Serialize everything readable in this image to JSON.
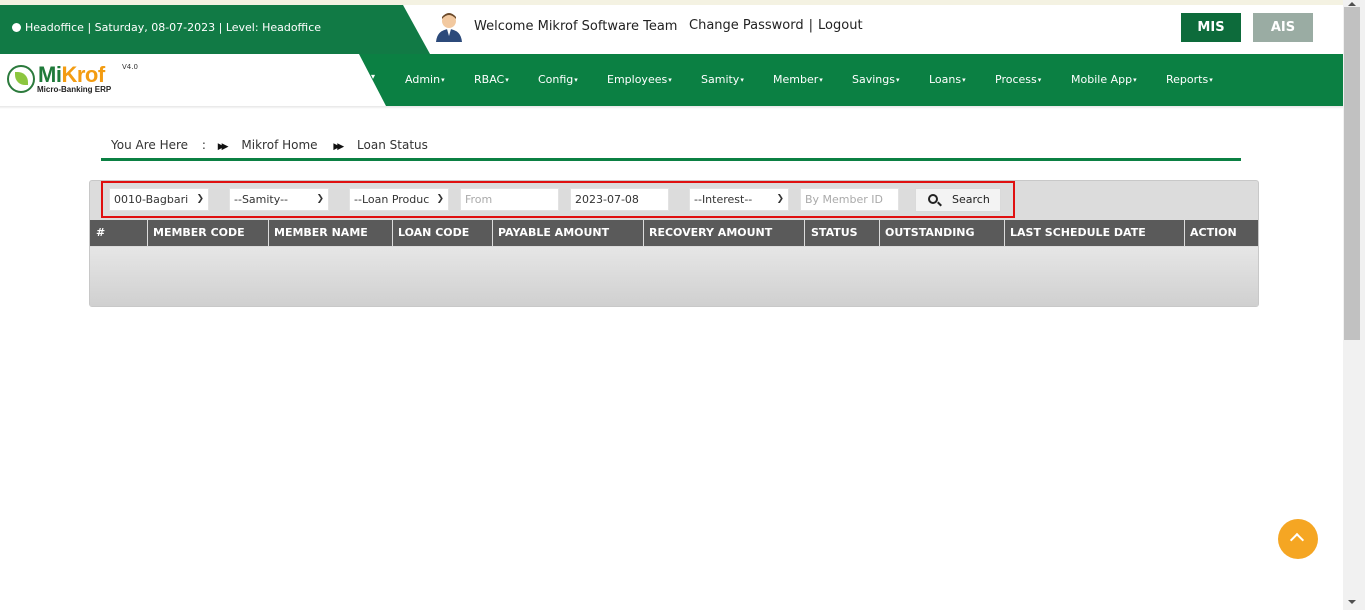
{
  "header": {
    "info_text": "Headoffice | Saturday, 08-07-2023 | Level: Headoffice",
    "welcome": "Welcome Mikrof Software Team",
    "change_password": "Change Password",
    "separator": "|",
    "logout": "Logout",
    "mis_label": "MIS",
    "ais_label": "AIS"
  },
  "logo": {
    "name_part1": "Mi",
    "name_part2": "Krof",
    "version": "V4.0",
    "subtitle": "Micro-Banking ERP"
  },
  "nav": {
    "items": [
      {
        "label": "Admin"
      },
      {
        "label": "RBAC"
      },
      {
        "label": "Config"
      },
      {
        "label": "Employees"
      },
      {
        "label": "Samity"
      },
      {
        "label": "Member"
      },
      {
        "label": "Savings"
      },
      {
        "label": "Loans"
      },
      {
        "label": "Process"
      },
      {
        "label": "Mobile App"
      },
      {
        "label": "Reports"
      }
    ]
  },
  "breadcrumb": {
    "you_are_here": "You Are Here",
    "colon": ":",
    "home": "Mikrof Home",
    "current": "Loan Status"
  },
  "filters": {
    "branch": "0010-Bagbari",
    "samity": "--Samity--",
    "loan_product": "--Loan Produc",
    "from_placeholder": "From",
    "to_date": "2023-07-08",
    "interest": "--Interest--",
    "member_id_placeholder": "By Member ID",
    "search_label": "Search"
  },
  "table": {
    "columns": [
      "#",
      "MEMBER CODE",
      "MEMBER NAME",
      "LOAN CODE",
      "PAYABLE AMOUNT",
      "RECOVERY AMOUNT",
      "STATUS",
      "OUTSTANDING",
      "LAST SCHEDULE DATE",
      "ACTION"
    ],
    "rows": []
  },
  "colors": {
    "brand_green": "#0b8043",
    "dark_green": "#117a45",
    "accent_orange": "#f5a623",
    "highlight_red": "#e01010"
  }
}
